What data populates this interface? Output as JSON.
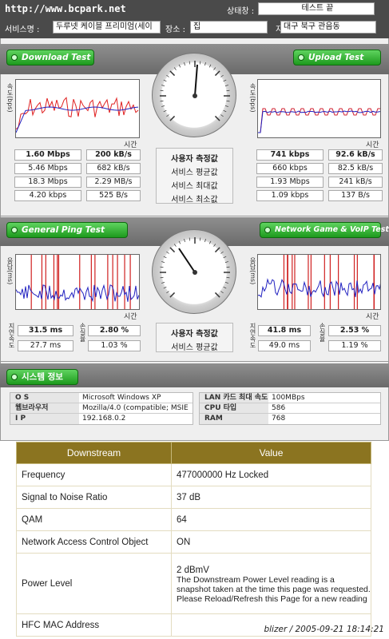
{
  "header": {
    "url": "http://www.bcpark.net",
    "status_label": "상태창 :",
    "status_value": "테스트 끝",
    "service_label": "서비스명 :",
    "service_value": "두루넷 케이블 프리미엄(세이",
    "place_label": "장소 :",
    "place_value": "집",
    "region_label": "지역 :",
    "region_value": "대구 북구 관음동"
  },
  "speed_panel": {
    "download_btn": "Download Test",
    "upload_btn": "Upload Test",
    "y_label": "속도(bps)",
    "x_label": "시간",
    "gauge_ticks": [
      "100k",
      "500k",
      "1M",
      "3M",
      "5M",
      "10M",
      "0"
    ],
    "mid_labels": [
      "사용자 측정값",
      "서비스 평균값",
      "서비스 최대값",
      "서비스 최소값"
    ],
    "download": [
      [
        "1.60 Mbps",
        "200 kB/s"
      ],
      [
        "5.46 Mbps",
        "682 kB/s"
      ],
      [
        "18.3 Mbps",
        "2.29 MB/s"
      ],
      [
        "4.20 kbps",
        "525 B/s"
      ]
    ],
    "upload": [
      [
        "741 kbps",
        "92.6 kB/s"
      ],
      [
        "660 kbps",
        "82.5 kB/s"
      ],
      [
        "1.93 Mbps",
        "241 kB/s"
      ],
      [
        "1.09 kbps",
        "137 B/s"
      ]
    ]
  },
  "ping_panel": {
    "ping_btn": "General Ping Test",
    "game_btn": "Network Game & VoIP Test",
    "y_label": "응답(ms)",
    "x_label": "시간",
    "delay_label": "지연속도",
    "loss_label": "손실율",
    "mid_labels": [
      "사용자 측정값",
      "서비스 평균값"
    ],
    "ping": [
      [
        "31.5 ms",
        "2.80 %"
      ],
      [
        "27.7 ms",
        "1.03 %"
      ]
    ],
    "game": [
      [
        "41.8 ms",
        "2.53 %"
      ],
      [
        "49.0 ms",
        "1.19 %"
      ]
    ],
    "gauge_ticks": [
      "10",
      "20",
      "30",
      "40",
      "50",
      "60",
      "70",
      "80",
      "90",
      "100",
      "150",
      "200",
      "ms"
    ]
  },
  "system": {
    "btn": "시스템 정보",
    "left": [
      [
        "O S",
        "Microsoft Windows XP"
      ],
      [
        "웹브라우저",
        "Mozilla/4.0 (compatible; MSIE"
      ],
      [
        "I P",
        "192.168.0.2"
      ]
    ],
    "right": [
      [
        "LAN 카드 최대 속도",
        "100MBps"
      ],
      [
        "CPU 타입",
        "586"
      ],
      [
        "RAM",
        "768"
      ]
    ]
  },
  "table": {
    "headers": [
      "Downstream",
      "Value"
    ],
    "rows": [
      [
        "Frequency",
        "477000000 Hz Locked"
      ],
      [
        "Signal to Noise Ratio",
        "37 dB"
      ],
      [
        "QAM",
        "64"
      ],
      [
        "Network Access Control Object",
        "ON"
      ],
      [
        "Power Level",
        "2 dBmV"
      ],
      [
        "HFC MAC Address",
        ""
      ]
    ],
    "power_note": "The Downstream Power Level reading is a snapshot taken at the time this page was requested. Please Reload/Refresh this Page for a new reading"
  },
  "watermark": "blizer / 2005-09-21 18:14:21",
  "colors": {
    "green_button": "#1d9a1d",
    "table_header": "#8b7420",
    "download_line_red": "#e02020",
    "download_line_blue": "#2020c0"
  }
}
